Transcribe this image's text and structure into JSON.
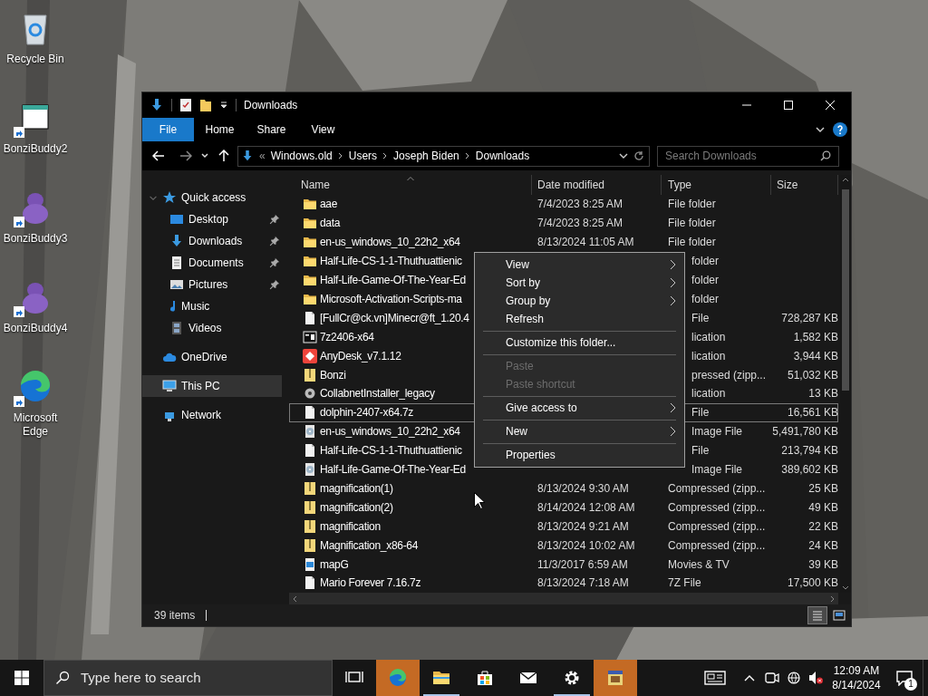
{
  "desktop": {
    "icons": [
      {
        "label": "Recycle Bin",
        "kind": "recycle",
        "shortcut": false
      },
      {
        "label": "BonziBuddy2",
        "kind": "window",
        "shortcut": true
      },
      {
        "label": "BonziBuddy3",
        "kind": "figure",
        "shortcut": true
      },
      {
        "label": "BonziBuddy4",
        "kind": "figure",
        "shortcut": true
      },
      {
        "label": "Microsoft Edge",
        "kind": "swirl",
        "shortcut": true
      }
    ]
  },
  "window": {
    "title": "Downloads",
    "ribbon_tabs": [
      {
        "label": "File",
        "selected": true
      },
      {
        "label": "Home",
        "selected": false
      },
      {
        "label": "Share",
        "selected": false
      },
      {
        "label": "View",
        "selected": false
      }
    ],
    "address": {
      "overflow_mark": "«",
      "crumbs": [
        "Windows.old",
        "Users",
        "Joseph Biden",
        "Downloads"
      ]
    },
    "search": {
      "placeholder": "Search Downloads"
    },
    "navigation": [
      {
        "label": "Quick access",
        "kind": "star",
        "expanded": true,
        "selected": false,
        "children": [
          {
            "label": "Desktop",
            "kind": "desktop",
            "pinned": true,
            "selected": false
          },
          {
            "label": "Downloads",
            "kind": "download",
            "pinned": true,
            "selected": false
          },
          {
            "label": "Documents",
            "kind": "doc",
            "pinned": true,
            "selected": false
          },
          {
            "label": "Pictures",
            "kind": "pictures",
            "pinned": true,
            "selected": false
          },
          {
            "label": "Music",
            "kind": "music",
            "selected": false
          },
          {
            "label": "Videos",
            "kind": "videos",
            "selected": false
          }
        ]
      },
      {
        "label": "OneDrive",
        "kind": "cloud",
        "selected": false
      },
      {
        "label": "This PC",
        "kind": "pc",
        "selected": true
      },
      {
        "label": "Network",
        "kind": "network",
        "selected": false
      }
    ],
    "columns": [
      {
        "label": "Name",
        "sorted": true
      },
      {
        "label": "Date modified",
        "sorted": false
      },
      {
        "label": "Type",
        "sorted": false
      },
      {
        "label": "Size",
        "sorted": false
      }
    ],
    "rows": [
      {
        "name": "aae",
        "date": "7/4/2023 8:25 AM",
        "type": "File folder",
        "kind": "folder",
        "focused": false
      },
      {
        "name": "data",
        "date": "7/4/2023 8:25 AM",
        "type": "File folder",
        "kind": "folder",
        "focused": false
      },
      {
        "name": "en-us_windows_10_22h2_x64",
        "date": "8/13/2024 11:05 AM",
        "type": "File folder",
        "kind": "folder",
        "focused": false
      },
      {
        "name": "Half-Life-CS-1-1-Thuthuattienic",
        "type": "folder",
        "kind": "folder",
        "focused": false
      },
      {
        "name": "Half-Life-Game-Of-The-Year-Ed",
        "type": "folder",
        "kind": "folder",
        "focused": false
      },
      {
        "name": "Microsoft-Activation-Scripts-ma",
        "type": "folder",
        "kind": "folder",
        "focused": false
      },
      {
        "name": "[FullCr@ck.vn]Minecr@ft_1.20.4",
        "type": "File",
        "size": "728,287 KB",
        "kind": "file",
        "focused": false
      },
      {
        "name": "7z2406-x64",
        "type": "lication",
        "size": "1,582 KB",
        "kind": "sevenzip",
        "focused": false
      },
      {
        "name": "AnyDesk_v7.1.12",
        "type": "lication",
        "size": "3,944 KB",
        "kind": "anydesk",
        "focused": false
      },
      {
        "name": "Bonzi",
        "type": "pressed (zipp...",
        "size": "51,032 KB",
        "kind": "zip",
        "focused": false
      },
      {
        "name": "CollabnetInstaller_legacy",
        "type": "lication",
        "size": "13 KB",
        "kind": "installer",
        "focused": false
      },
      {
        "name": "dolphin-2407-x64.7z",
        "type": "File",
        "size": "16,561 KB",
        "kind": "file",
        "focused": true
      },
      {
        "name": "en-us_windows_10_22h2_x64",
        "type": "Image File",
        "size": "5,491,780 KB",
        "kind": "disc",
        "focused": false
      },
      {
        "name": "Half-Life-CS-1-1-Thuthuattienic",
        "type": "File",
        "size": "213,794 KB",
        "kind": "file",
        "focused": false
      },
      {
        "name": "Half-Life-Game-Of-The-Year-Ed",
        "type": "Image File",
        "size": "389,602 KB",
        "kind": "disc",
        "focused": false
      },
      {
        "name": "magnification(1)",
        "date": "8/13/2024 9:30 AM",
        "type": "Compressed (zipp...",
        "size": "25 KB",
        "kind": "zip",
        "focused": false
      },
      {
        "name": "magnification(2)",
        "date": "8/14/2024 12:08 AM",
        "type": "Compressed (zipp...",
        "size": "49 KB",
        "kind": "zip",
        "focused": false
      },
      {
        "name": "magnification",
        "date": "8/13/2024 9:21 AM",
        "type": "Compressed (zipp...",
        "size": "22 KB",
        "kind": "zip",
        "focused": false
      },
      {
        "name": "Magnification_x86-64",
        "date": "8/13/2024 10:02 AM",
        "type": "Compressed (zipp...",
        "size": "24 KB",
        "kind": "zip",
        "focused": false
      },
      {
        "name": "mapG",
        "date": "11/3/2017 6:59 AM",
        "type": "Movies & TV",
        "size": "39 KB",
        "kind": "video",
        "focused": false
      },
      {
        "name": "Mario Forever 7.16.7z",
        "date": "8/13/2024 7:18 AM",
        "type": "7Z File",
        "size": "17,500 KB",
        "kind": "file",
        "focused": false
      }
    ],
    "context_menu": [
      {
        "kind": "item",
        "label": "View",
        "submenu": true,
        "disabled": false
      },
      {
        "kind": "item",
        "label": "Sort by",
        "submenu": true,
        "disabled": false
      },
      {
        "kind": "item",
        "label": "Group by",
        "submenu": true,
        "disabled": false
      },
      {
        "kind": "item",
        "label": "Refresh",
        "submenu": false,
        "disabled": false
      },
      {
        "kind": "separator"
      },
      {
        "kind": "item",
        "label": "Customize this folder...",
        "submenu": false,
        "disabled": false
      },
      {
        "kind": "separator"
      },
      {
        "kind": "item",
        "label": "Paste",
        "submenu": false,
        "disabled": true
      },
      {
        "kind": "item",
        "label": "Paste shortcut",
        "submenu": false,
        "disabled": true
      },
      {
        "kind": "separator"
      },
      {
        "kind": "item",
        "label": "Give access to",
        "submenu": true,
        "disabled": false
      },
      {
        "kind": "separator"
      },
      {
        "kind": "item",
        "label": "New",
        "submenu": true,
        "disabled": false
      },
      {
        "kind": "separator"
      },
      {
        "kind": "item",
        "label": "Properties",
        "submenu": false,
        "disabled": false
      }
    ],
    "status_bar": {
      "count": "39 items",
      "views": [
        {
          "kind": "details",
          "selected": true
        },
        {
          "kind": "tiles",
          "selected": false
        }
      ]
    }
  },
  "taskbar": {
    "search": {
      "placeholder": "Type here to search"
    },
    "apps": [
      {
        "kind": "task-view",
        "flash": false,
        "open": false
      },
      {
        "kind": "edge",
        "flash": true,
        "open": false
      },
      {
        "kind": "explorer",
        "flash": false,
        "open": true
      },
      {
        "kind": "store",
        "flash": false,
        "open": false
      },
      {
        "kind": "mail",
        "flash": false,
        "open": false
      },
      {
        "kind": "settings",
        "flash": false,
        "open": true
      },
      {
        "kind": "app",
        "flash": true,
        "open": false
      }
    ],
    "tray": [
      {
        "kind": "news"
      },
      {
        "kind": "chevron"
      },
      {
        "kind": "camera"
      },
      {
        "kind": "globe"
      },
      {
        "kind": "volume-muted"
      }
    ],
    "time": "12:09 AM",
    "date": "8/14/2024",
    "notifications": "1"
  }
}
